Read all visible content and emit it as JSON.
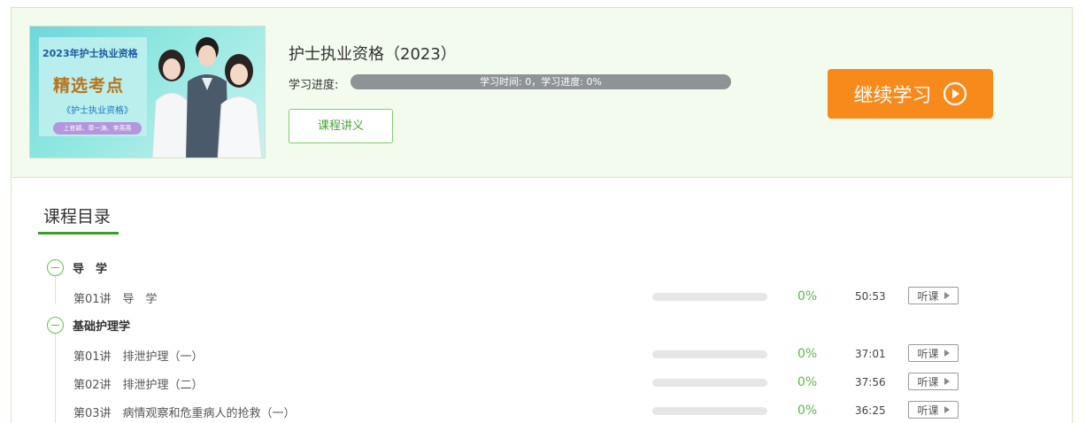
{
  "course": {
    "title": "护士执业资格（2023）",
    "cover": {
      "year_text": "2023年护士执业资格",
      "headline": "精选考点",
      "subtitle": "《护士执业资格》",
      "teachers": "上官颖、章一涛、李燕燕"
    },
    "progress_label": "学习进度:",
    "progress_text": "学习时间: 0，学习进度: 0%",
    "progress_percent": 0,
    "handout_button": "课程讲义",
    "continue_button": "继续学习"
  },
  "catalog": {
    "title": "课程目录",
    "listen_label": "听课",
    "chapters": [
      {
        "name": "导　学",
        "lessons": [
          {
            "name": "第01讲　导　学",
            "percent_text": "0%",
            "progress": 0,
            "duration": "50:53"
          }
        ]
      },
      {
        "name": "基础护理学",
        "lessons": [
          {
            "name": "第01讲　排泄护理（一）",
            "percent_text": "0%",
            "progress": 0,
            "duration": "37:01"
          },
          {
            "name": "第02讲　排泄护理（二）",
            "percent_text": "0%",
            "progress": 0,
            "duration": "37:56"
          },
          {
            "name": "第03讲　病情观察和危重病人的抢救（一）",
            "percent_text": "0%",
            "progress": 0,
            "duration": "36:25"
          }
        ]
      }
    ]
  },
  "colors": {
    "accent_green": "#4aa236",
    "header_bg": "#f2fbee",
    "continue_orange": "#f78a1a",
    "progress_grey": "#8e9396"
  },
  "icons": {
    "play": "play-circle-icon",
    "collapse": "minus-circle-icon",
    "listen": "triangle-right-icon"
  }
}
